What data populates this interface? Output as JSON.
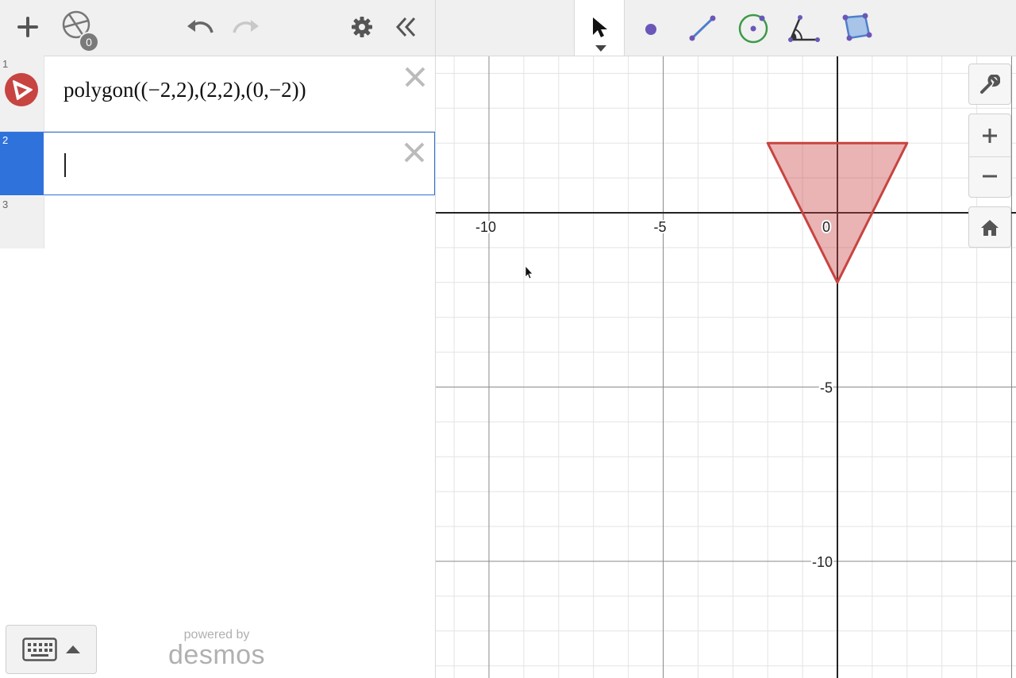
{
  "left_toolbar": {
    "add_icon": "plus-icon",
    "geometry_icon": "circle-construction-icon",
    "geometry_badge": "0",
    "undo_icon": "undo-icon",
    "redo_icon": "redo-icon",
    "settings_icon": "gear-icon",
    "collapse_icon": "double-chevron-left-icon"
  },
  "expressions": [
    {
      "number": "1",
      "latex_text": "polygon((−2,2),(2,2),(0,−2))",
      "color": "#c74440",
      "icon": "polygon-icon"
    },
    {
      "number": "2",
      "latex_text": "",
      "focused": true
    },
    {
      "number": "3",
      "latex_text": ""
    }
  ],
  "footer": {
    "powered_by": "powered by",
    "brand": "desmos",
    "keyboard_icon": "keyboard-icon"
  },
  "geo_toolbar": {
    "tools": [
      "select-tool",
      "point-tool",
      "segment-tool",
      "circle-tool",
      "angle-tool",
      "polygon-tool"
    ],
    "active": "select-tool"
  },
  "graph": {
    "x_ticks": [
      "-10",
      "-5",
      "0"
    ],
    "y_ticks": [
      "-5",
      "-10"
    ],
    "polygon_vertices": [
      [
        -2,
        2
      ],
      [
        2,
        2
      ],
      [
        0,
        -2
      ]
    ],
    "polygon_color": "#c74440"
  },
  "controls": [
    "wrench-icon",
    "zoom-in-icon",
    "zoom-out-icon",
    "home-icon"
  ]
}
